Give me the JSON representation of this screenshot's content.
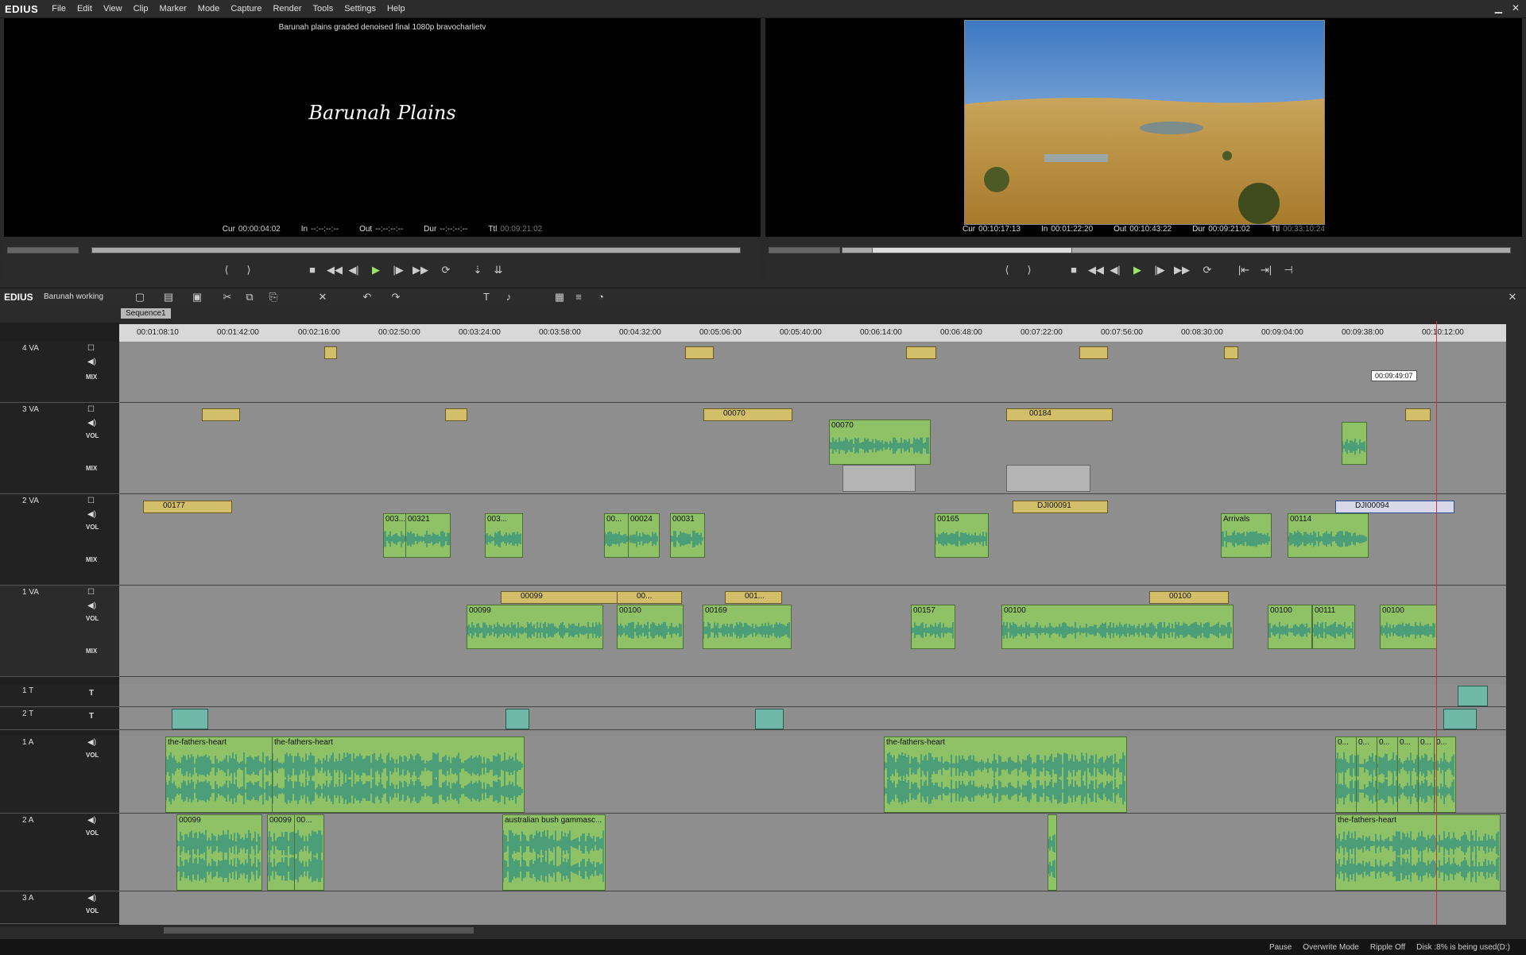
{
  "app": {
    "logo": "EDIUS",
    "project_name": "Barunah working",
    "sequence_tab": "Sequence1"
  },
  "menu": [
    "File",
    "Edit",
    "View",
    "Clip",
    "Marker",
    "Mode",
    "Capture",
    "Render",
    "Tools",
    "Settings",
    "Help"
  ],
  "player": {
    "title": "Barunah plains graded denoised final 1080p bravocharlietv",
    "overlay_text": "Barunah Plains",
    "cur": "00:00:04:02",
    "in": "--:--:--:--",
    "out": "--:--:--:--",
    "dur": "--:--:--:--",
    "ttl": "00:09:21:02"
  },
  "recorder": {
    "cur": "00:10:17:13",
    "in": "00:01:22:20",
    "out": "00:10:43:22",
    "dur": "00:09:21:02",
    "ttl": "00:33:10:24"
  },
  "ruler_ticks": [
    "00:01:08:10",
    "00:01:42:00",
    "00:02:16:00",
    "00:02:50:00",
    "00:03:24:00",
    "00:03:58:00",
    "00:04:32:00",
    "00:05:06:00",
    "00:05:40:00",
    "00:06:14:00",
    "00:06:48:00",
    "00:07:22:00",
    "00:07:56:00",
    "00:08:30:00",
    "00:09:04:00",
    "00:09:38:00",
    "00:10:12:00"
  ],
  "tracks": [
    {
      "name": "4 VA"
    },
    {
      "name": "3 VA"
    },
    {
      "name": "2 VA"
    },
    {
      "name": "1 VA"
    },
    {
      "name": "1 T"
    },
    {
      "name": "2 T"
    },
    {
      "name": "1 A"
    },
    {
      "name": "2 A"
    },
    {
      "name": "3 A"
    }
  ],
  "labels": {
    "mix": "MIX",
    "vol": "VOL",
    "t": "T"
  },
  "clips": {
    "v3": [
      "00070",
      "00070",
      "00184"
    ],
    "v2": [
      "00177",
      "003...",
      "00321",
      "003...",
      "00...",
      "00024",
      "00031",
      "00165",
      "DJI00091",
      "Arrivals",
      "00114",
      "DJI00094"
    ],
    "v1": [
      "00099",
      "00099",
      "00...",
      "00100",
      "001...",
      "00169",
      "00157",
      "00100",
      "00100",
      "00100",
      "00111",
      "00100"
    ],
    "a1": [
      "the-fathers-heart",
      "the-fathers-heart",
      "the-fathers-heart",
      "0...",
      "0...",
      "0...",
      "0...",
      "0...",
      "0..."
    ],
    "a2": [
      "00099",
      "00099",
      "00...",
      "australian bush gammasc...",
      "the-fathers-heart"
    ]
  },
  "tooltip": "00:09:49:07",
  "status": {
    "state": "Pause",
    "mode": "Overwrite Mode",
    "ripple": "Ripple Off",
    "disk": "Disk :8% is being used(D:)"
  },
  "colors": {
    "video_clip": "#d3bf6a",
    "audio_clip": "#8fc167",
    "waveform": "#2f8f80",
    "playhead": "#d03030",
    "title_clip": "#6fb8a8"
  }
}
